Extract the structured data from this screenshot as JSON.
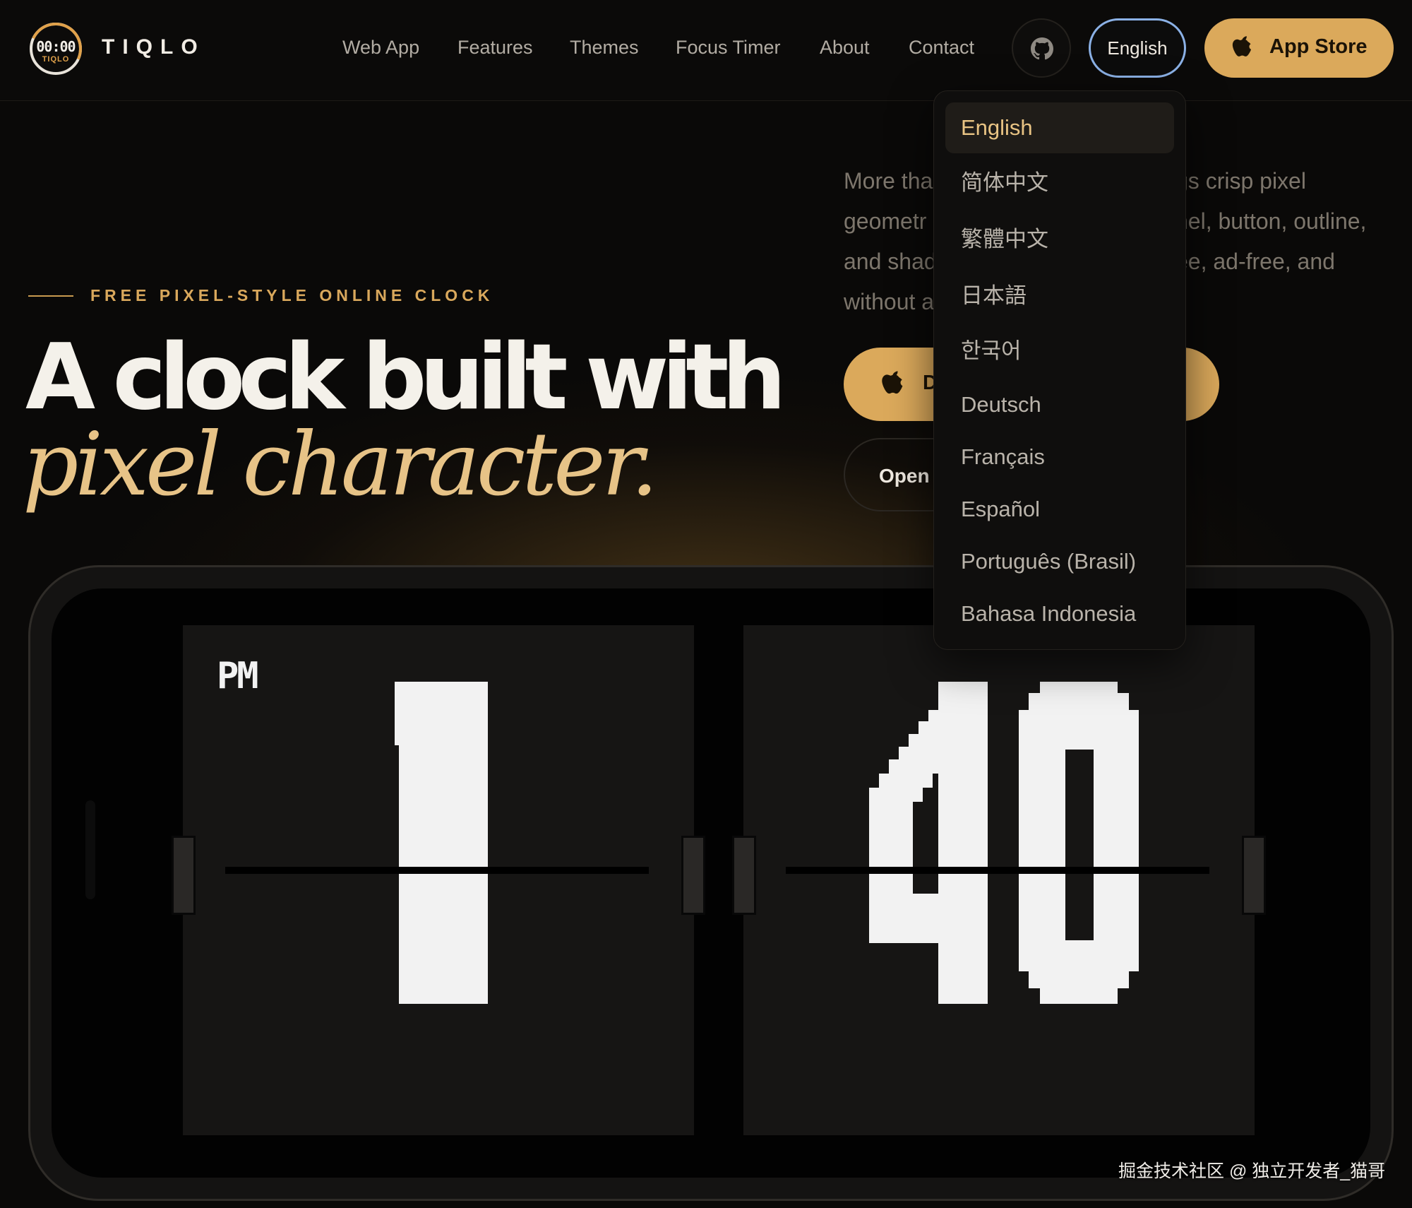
{
  "nav": {
    "logo_time": "00:00",
    "logo_sub": "TIQLO",
    "brand": "TIQLO",
    "links": [
      "Web App",
      "Features",
      "Themes",
      "Focus Timer",
      "About",
      "Contact"
    ],
    "github_icon": "github-icon",
    "language_button": "English",
    "app_store_label": "App Store",
    "app_store_icon": "apple-icon"
  },
  "hero": {
    "eyebrow": "FREE PIXEL-STYLE ONLINE CLOCK",
    "headline_line1": "A clock built with",
    "headline_line2": "pixel character.",
    "description_lines": [
      "More tha",
      "gs crisp pixel",
      "geometr",
      "nel, button, outline,",
      "and shad",
      "ee, ad-free, and",
      "without a"
    ],
    "download_label": "D",
    "open_label": "Open"
  },
  "clock": {
    "period": "PM",
    "hour": "1",
    "minute": "40"
  },
  "language_menu": {
    "selected": "English",
    "options": [
      "English",
      "简体中文",
      "繁體中文",
      "日本語",
      "한국어",
      "Deutsch",
      "Français",
      "Español",
      "Português (Brasil)",
      "Bahasa Indonesia"
    ]
  },
  "colors": {
    "accent": "#dba95b",
    "headline_accent": "#e7c387",
    "focus_ring": "#8bb1e6",
    "background": "#0a0908"
  },
  "watermark": "掘金技术社区 @ 独立开发者_猫哥"
}
